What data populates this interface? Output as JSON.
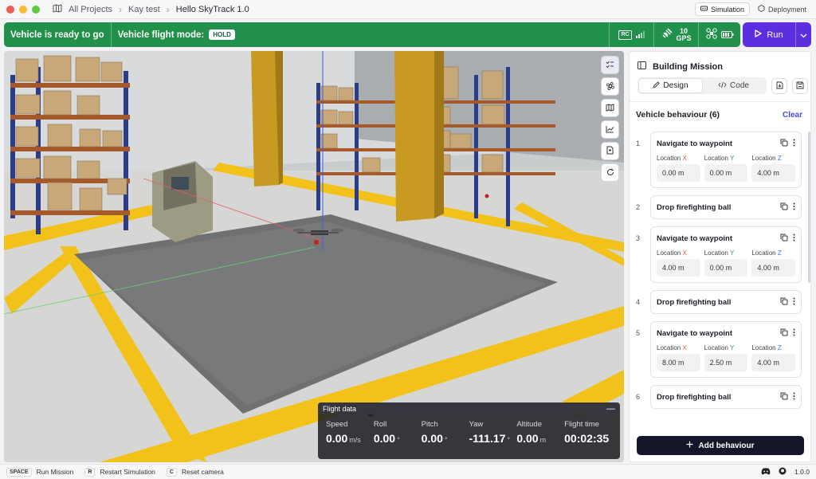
{
  "window": {
    "breadcrumbs": [
      "All Projects",
      "Kay test",
      "Hello SkyTrack 1.0"
    ],
    "mode_tabs": {
      "simulation": "Simulation",
      "deployment": "Deployment"
    },
    "traffic_colors": [
      "#ee5d57",
      "#f5bd2f",
      "#5fc83f"
    ]
  },
  "statusbar": {
    "ready_text": "Vehicle is ready to go",
    "flight_mode_label": "Vehicle flight mode:",
    "flight_mode_value": "HOLD",
    "rc_label": "RC",
    "gps_count": "10",
    "gps_label": "GPS",
    "accent": "#20904a"
  },
  "run_button": {
    "label": "Run",
    "color": "#5b2fe0"
  },
  "viewport": {
    "tools": [
      "checklist-icon",
      "command-icon",
      "map-icon",
      "chart-icon",
      "document-icon",
      "refresh-icon"
    ]
  },
  "flight_data": {
    "title": "Flight data",
    "minimize": "—",
    "fields": {
      "speed": {
        "label": "Speed",
        "value": "0.00",
        "unit": "m/s"
      },
      "roll": {
        "label": "Roll",
        "value": "0.00",
        "unit": "°"
      },
      "pitch": {
        "label": "Pitch",
        "value": "0.00",
        "unit": "°"
      },
      "yaw": {
        "label": "Yaw",
        "value": "-111.17",
        "unit": "°"
      },
      "altitude": {
        "label": "Altitude",
        "value": "0.00",
        "unit": "m"
      },
      "flight_time": {
        "label": "Flight time",
        "value": "00:02:35"
      }
    }
  },
  "panel": {
    "title": "Building Mission",
    "tab_design": "Design",
    "tab_code": "Code",
    "behaviour_header": "Vehicle behaviour (6)",
    "clear_label": "Clear",
    "location_labels": {
      "x": "Location",
      "y": "Location",
      "z": "Location",
      "ax_x": "X",
      "ax_y": "Y",
      "ax_z": "Z"
    },
    "items": [
      {
        "num": "1",
        "title": "Navigate to waypoint",
        "x": "0.00 m",
        "y": "0.00 m",
        "z": "4.00 m"
      },
      {
        "num": "2",
        "title": "Drop firefighting ball"
      },
      {
        "num": "3",
        "title": "Navigate to waypoint",
        "x": "4.00 m",
        "y": "0.00 m",
        "z": "4.00 m"
      },
      {
        "num": "4",
        "title": "Drop firefighting ball"
      },
      {
        "num": "5",
        "title": "Navigate to waypoint",
        "x": "8.00 m",
        "y": "2.50 m",
        "z": "4.00 m"
      },
      {
        "num": "6",
        "title": "Drop firefighting ball"
      }
    ],
    "add_label": "Add behaviour"
  },
  "bottombar": {
    "shortcuts": [
      {
        "key": "SPACE",
        "label": "Run Mission"
      },
      {
        "key": "R",
        "label": "Restart Simulation"
      },
      {
        "key": "C",
        "label": "Reset camera"
      }
    ],
    "version": "1.0.0"
  }
}
